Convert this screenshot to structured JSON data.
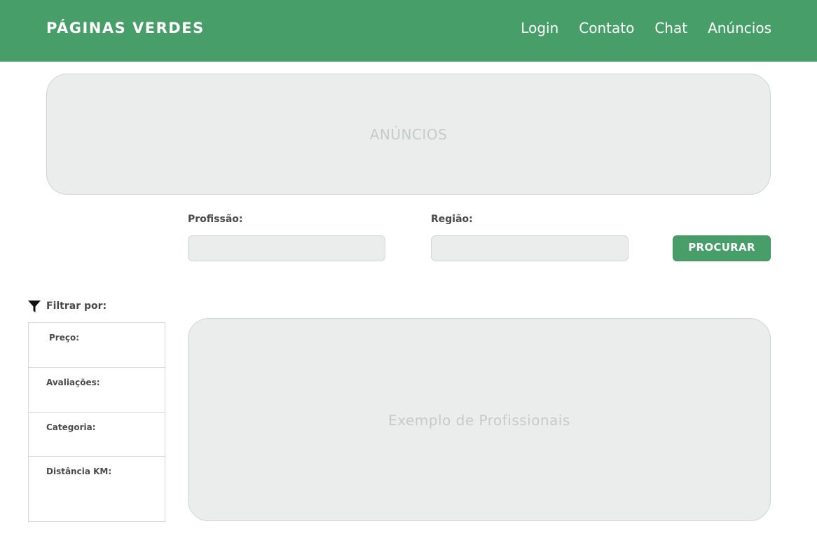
{
  "header": {
    "brand": "PÁGINAS VERDES",
    "nav": [
      "Login",
      "Contato",
      "Chat",
      "Anúncios"
    ],
    "background_color": "#479e69"
  },
  "ads_banner": {
    "label": "ANÚNCIOS"
  },
  "search": {
    "profession_label": "Profissão:",
    "profession_value": "",
    "region_label": "Região:",
    "region_value": "",
    "button_label": "PROCURAR"
  },
  "filters": {
    "title": "Filtrar por:",
    "icon": "filter-funnel-icon",
    "sections": [
      {
        "label": "Preço:"
      },
      {
        "label": "Avaliações:"
      },
      {
        "label": "Categoria:"
      },
      {
        "label": "Distância KM:"
      }
    ]
  },
  "results": {
    "label": "Exemplo de Profissionais"
  }
}
